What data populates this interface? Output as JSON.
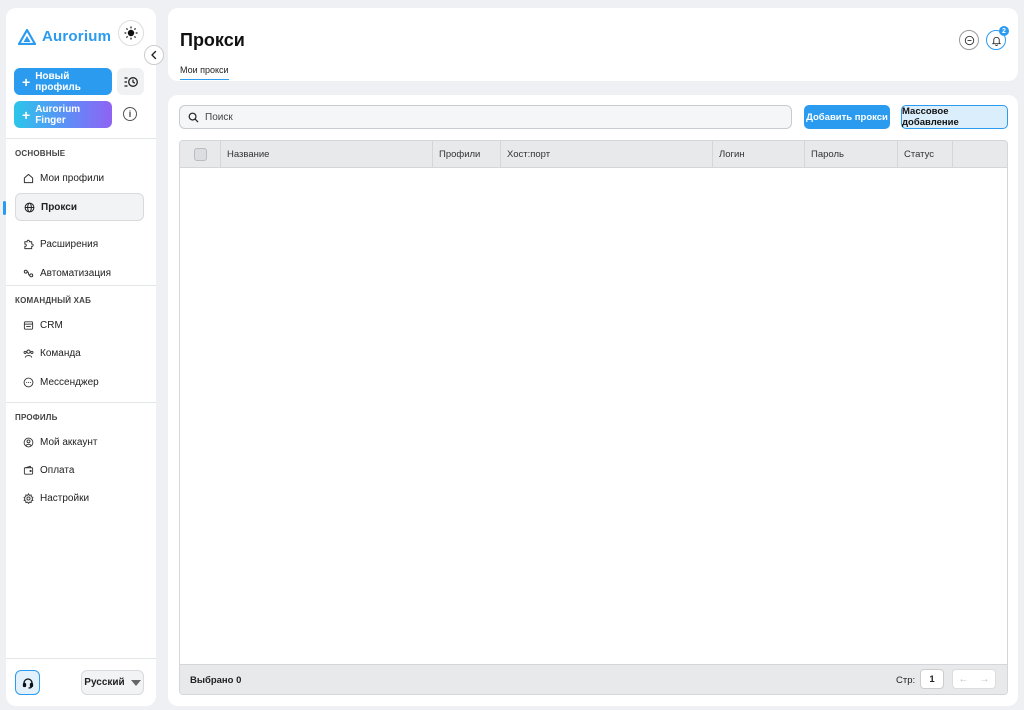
{
  "app": {
    "name": "Aurorium",
    "accent": "#2b9bf0"
  },
  "sidebar": {
    "new_profile_label": "Новый профиль",
    "finger_label": "Aurorium Finger",
    "sections": [
      {
        "title": "ОСНОВНЫЕ",
        "items": [
          {
            "label": "Мои профили",
            "icon": "home-icon"
          },
          {
            "label": "Прокси",
            "icon": "globe-icon",
            "active": true
          },
          {
            "label": "Расширения",
            "icon": "puzzle-icon"
          },
          {
            "label": "Автоматизация",
            "icon": "automation-icon"
          }
        ]
      },
      {
        "title": "КОМАНДНЫЙ ХАБ",
        "items": [
          {
            "label": "CRM",
            "icon": "crm-icon"
          },
          {
            "label": "Команда",
            "icon": "team-icon"
          },
          {
            "label": "Мессенджер",
            "icon": "chat-icon"
          }
        ]
      },
      {
        "title": "ПРОФИЛЬ",
        "items": [
          {
            "label": "Мой аккаунт",
            "icon": "user-circle-icon"
          },
          {
            "label": "Оплата",
            "icon": "wallet-icon"
          },
          {
            "label": "Настройки",
            "icon": "gear-icon"
          }
        ]
      }
    ],
    "language": "Русский"
  },
  "header": {
    "title": "Прокси",
    "tab": "Мои прокси",
    "notification_count": "2"
  },
  "toolbar": {
    "search_placeholder": "Поиск",
    "add_label": "Добавить прокси",
    "bulk_label": "Массовое добавление"
  },
  "table": {
    "columns": [
      "Название",
      "Профили",
      "Хост:порт",
      "Логин",
      "Пароль",
      "Статус"
    ],
    "rows": []
  },
  "footer": {
    "selected_label": "Выбрано 0",
    "page_label": "Стр:",
    "page_number": "1"
  }
}
